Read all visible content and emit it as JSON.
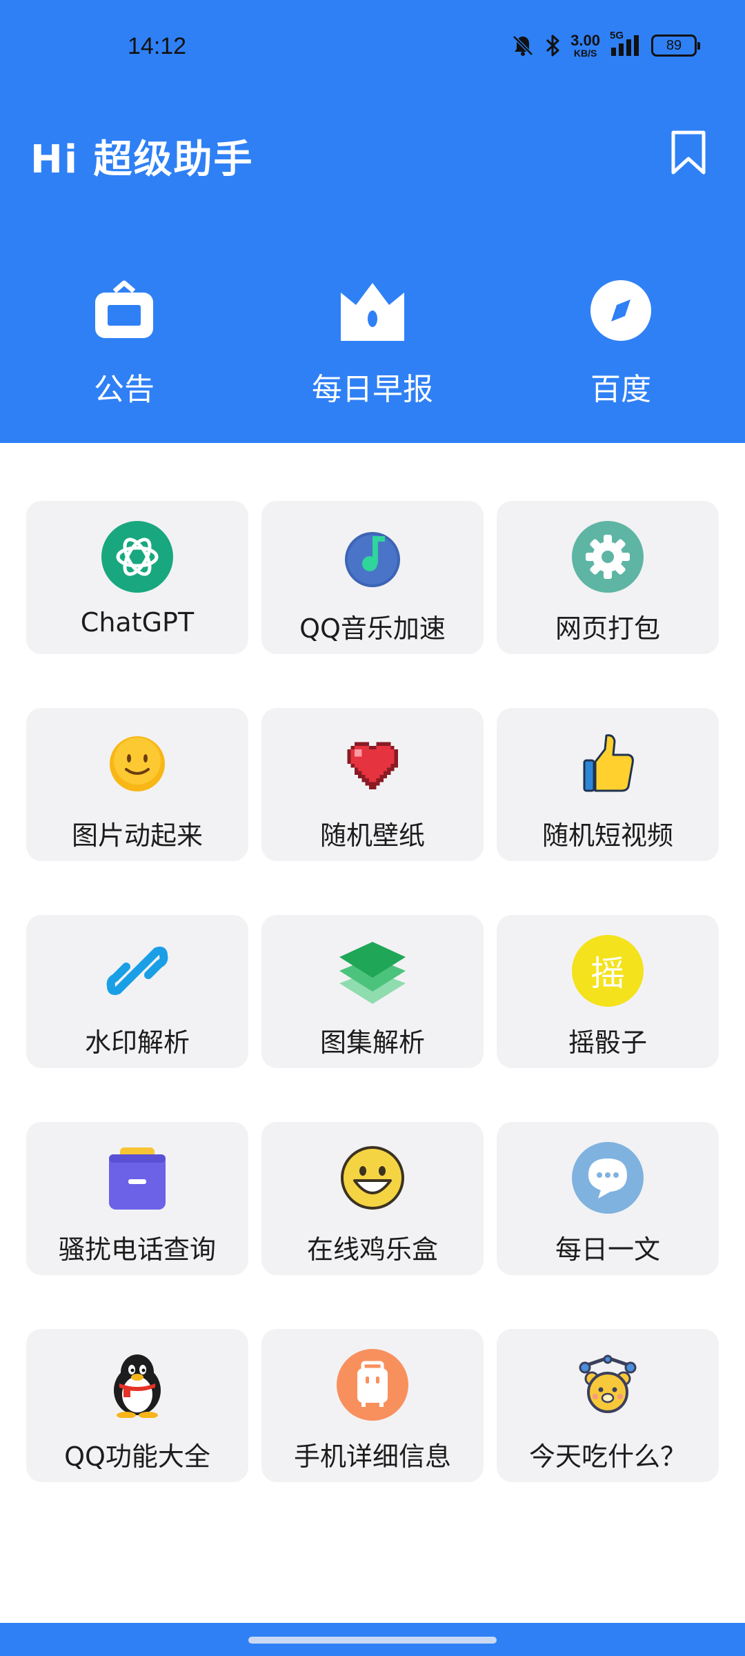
{
  "status_bar": {
    "time": "14:12",
    "net_speed_value": "3.00",
    "net_speed_unit": "KB/S",
    "network": "5G",
    "battery": "89",
    "icons": [
      "bell-muted-icon",
      "bluetooth-icon",
      "signal-icon"
    ]
  },
  "header": {
    "title": "Hi 超级助手",
    "bookmark_icon": "bookmark-icon",
    "background_color": "#2f80f5"
  },
  "quick_actions": [
    {
      "label": "公告",
      "icon": "announcement-icon"
    },
    {
      "label": "每日早报",
      "icon": "crown-icon"
    },
    {
      "label": "百度",
      "icon": "compass-icon"
    }
  ],
  "tools": [
    {
      "label": "ChatGPT",
      "icon": "openai-icon"
    },
    {
      "label": "QQ音乐加速",
      "icon": "music-note-icon"
    },
    {
      "label": "网页打包",
      "icon": "gear-icon"
    },
    {
      "label": "图片动起来",
      "icon": "smiley-icon"
    },
    {
      "label": "随机壁纸",
      "icon": "heart-icon"
    },
    {
      "label": "随机短视频",
      "icon": "thumbs-up-icon"
    },
    {
      "label": "水印解析",
      "icon": "link-icon"
    },
    {
      "label": "图集解析",
      "icon": "layers-icon"
    },
    {
      "label": "摇骰子",
      "icon": "shake-badge-icon",
      "badge_text": "摇"
    },
    {
      "label": "骚扰电话查询",
      "icon": "folder-icon"
    },
    {
      "label": "在线鸡乐盒",
      "icon": "grin-face-icon"
    },
    {
      "label": "每日一文",
      "icon": "chat-bubble-icon"
    },
    {
      "label": "QQ功能大全",
      "icon": "penguin-icon"
    },
    {
      "label": "手机详细信息",
      "icon": "suitcase-icon"
    },
    {
      "label": "今天吃什么？",
      "icon": "bear-icon"
    }
  ]
}
